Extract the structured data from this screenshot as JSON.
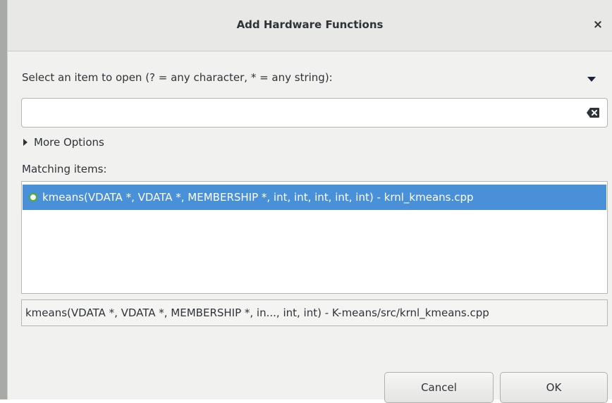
{
  "dialog": {
    "title": "Add Hardware Functions",
    "close_glyph": "×"
  },
  "prompt": "Select an item to open (? = any character, * = any string):",
  "search": {
    "value": "",
    "placeholder": ""
  },
  "more_options": "More Options",
  "matching_label": "Matching items:",
  "items": [
    {
      "icon": "function-icon",
      "label": "kmeans(VDATA *, VDATA *, MEMBERSHIP *, int, int, int, int, int) - krnl_kmeans.cpp",
      "selected": true
    }
  ],
  "status": "kmeans(VDATA *, VDATA *, MEMBERSHIP *, in..., int, int) - K-means/src/krnl_kmeans.cpp",
  "buttons": {
    "cancel": "Cancel",
    "ok": "OK"
  },
  "colors": {
    "selection": "#4a90d9",
    "function_icon": "#4caf26"
  }
}
